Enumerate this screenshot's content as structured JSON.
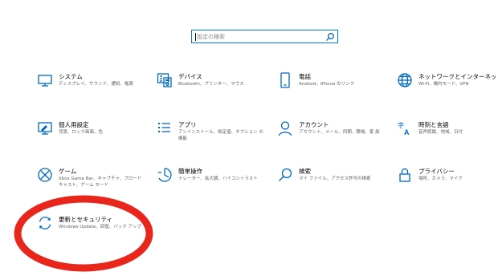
{
  "search": {
    "placeholder": "設定の検索"
  },
  "tiles": [
    {
      "title": "システム",
      "desc": "ディスプレイ、サウンド、通知、電源",
      "icon": "display-icon"
    },
    {
      "title": "デバイス",
      "desc": "Bluetooth、プリンター、マウス",
      "icon": "keyboard-icon"
    },
    {
      "title": "電話",
      "desc": "Android、iPhone のリンク",
      "icon": "phone-icon"
    },
    {
      "title": "ネットワークとインターネット",
      "desc": "Wi-Fi、機内モード、VPN",
      "icon": "globe-icon"
    },
    {
      "title": "個人用設定",
      "desc": "背景、ロック画面、色",
      "icon": "personalization-icon"
    },
    {
      "title": "アプリ",
      "desc": "アンインストール、既定値、オプション の機能",
      "icon": "apps-list-icon"
    },
    {
      "title": "アカウント",
      "desc": "アカウント、メール、同期、職場、家 族",
      "icon": "person-icon"
    },
    {
      "title": "時刻と言語",
      "desc": "音声認識、地域、日付",
      "icon": "time-language-icon"
    },
    {
      "title": "ゲーム",
      "desc": "Xbox Game Bar、キャプチャ、ブロード キャスト、ゲーム モード",
      "icon": "xbox-icon"
    },
    {
      "title": "簡単操作",
      "desc": "ナレーター、拡大鏡、ハイコントラスト",
      "icon": "ease-of-access-icon"
    },
    {
      "title": "検索",
      "desc": "マイ ファイル、アクセス許可の検索",
      "icon": "search-magnifier-icon"
    },
    {
      "title": "プライバシー",
      "desc": "場所、カメラ、マイク",
      "icon": "lock-icon"
    },
    {
      "title": "更新とセキュリティ",
      "desc": "Windows Update、回復、バック アップ",
      "icon": "update-sync-icon"
    }
  ],
  "colors": {
    "accent": "#0067c0",
    "annotation_ring": "#e8261c"
  }
}
